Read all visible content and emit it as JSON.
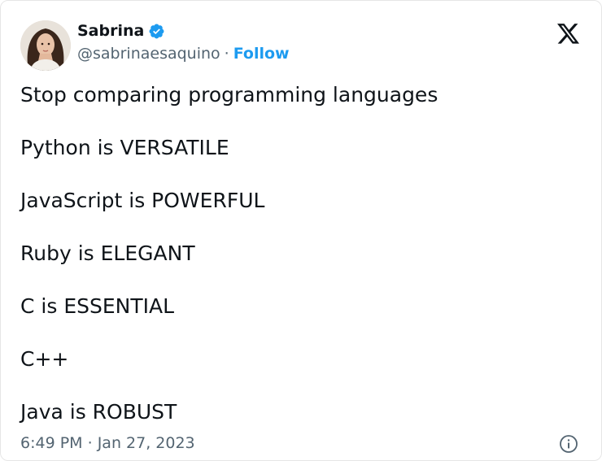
{
  "author": {
    "display_name": "Sabrina",
    "handle": "@sabrinaesaquino",
    "separator": "·",
    "follow_label": "Follow",
    "verified_icon": "verified-badge-icon",
    "verified_color": "#1d9bf0"
  },
  "platform_icon": "x-logo-icon",
  "tweet": {
    "lines": [
      "Stop comparing programming languages",
      "Python is VERSATILE",
      "JavaScript is POWERFUL",
      "Ruby is ELEGANT",
      "C is ESSENTIAL",
      "C++",
      "Java is ROBUST"
    ]
  },
  "footer": {
    "time": "6:49 PM",
    "separator": "·",
    "date": "Jan 27, 2023",
    "info_icon": "info-icon"
  },
  "colors": {
    "text": "#0f1419",
    "secondary": "#536471",
    "accent": "#1d9bf0"
  }
}
